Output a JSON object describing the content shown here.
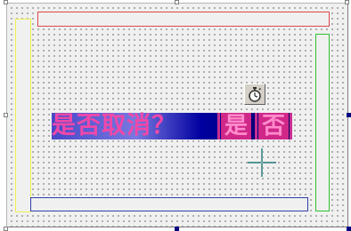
{
  "prompt": {
    "text": "是否取消？"
  },
  "choices": {
    "yes_label": "是",
    "no_label": "否"
  },
  "components": {
    "timer": "stopwatch-icon"
  },
  "colors": {
    "top_bar_border": "#e04848",
    "left_bar_border": "#f0f050",
    "right_bar_border": "#30c030",
    "bottom_bar_border": "#3040a8",
    "prompt_text": "#f048a8",
    "prompt_gradient_dark": "#000060"
  }
}
